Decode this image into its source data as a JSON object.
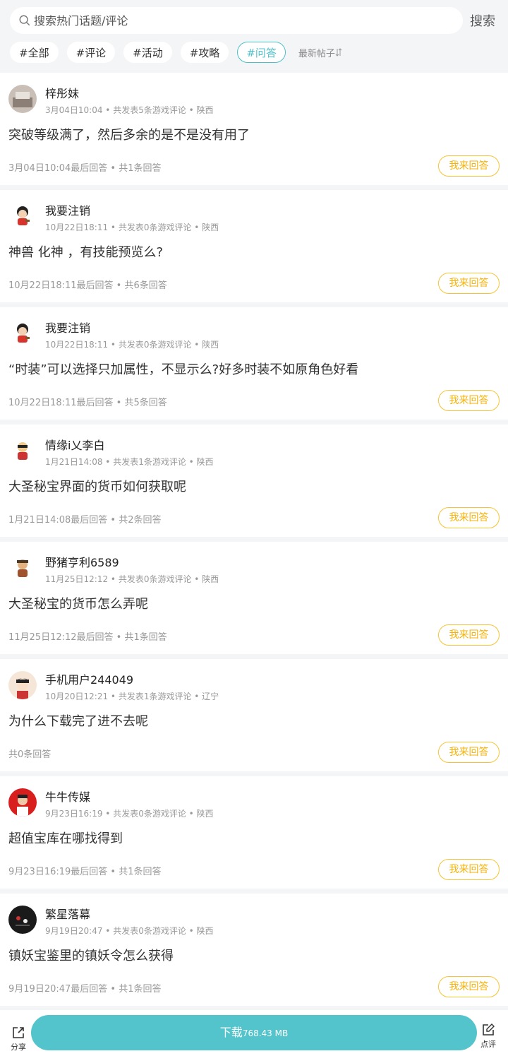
{
  "search": {
    "placeholder": "搜索热门话题/评论",
    "button_label": "搜索"
  },
  "tags": [
    {
      "label": "#全部"
    },
    {
      "label": "#评论"
    },
    {
      "label": "#活动"
    },
    {
      "label": "#攻略"
    },
    {
      "label": "#问答",
      "active": true
    }
  ],
  "sort_label": "最新帖子",
  "answer_label": "我来回答",
  "posts": [
    {
      "user": "梓彤妹",
      "meta": "3月04日10:04 • 共发表5条游戏评论 • 陕西",
      "title": "突破等级满了，然后多余的是不是没有用了",
      "footer": "3月04日10:04最后回答 • 共1条回答",
      "avatar_icon": "photo-avatar"
    },
    {
      "user": "我要注销",
      "meta": "10月22日18:11 • 共发表0条游戏评论 • 陕西",
      "title": "神兽 化神 ，有技能预览么?",
      "footer": "10月22日18:11最后回答 • 共6条回答",
      "avatar_icon": "cartoon-avatar"
    },
    {
      "user": "我要注销",
      "meta": "10月22日18:11 • 共发表0条游戏评论 • 陕西",
      "title": "“时装”可以选择只加属性，不显示么?好多时装不如原角色好看",
      "footer": "10月22日18:11最后回答 • 共5条回答",
      "avatar_icon": "cartoon-avatar"
    },
    {
      "user": "情缘i乂李白",
      "meta": "1月21日14:08 • 共发表1条游戏评论 • 陕西",
      "title": "大圣秘宝界面的货币如何获取呢",
      "footer": "1月21日14:08最后回答 • 共2条回答",
      "avatar_icon": "cartoon-avatar"
    },
    {
      "user": "野猪亨利6589",
      "meta": "11月25日12:12 • 共发表0条游戏评论 • 陕西",
      "title": "大圣秘宝的货币怎么弄呢",
      "footer": "11月25日12:12最后回答 • 共1条回答",
      "avatar_icon": "cartoon-avatar"
    },
    {
      "user": "手机用户244049",
      "meta": "10月20日12:21 • 共发表1条游戏评论 • 辽宁",
      "title": "为什么下载完了进不去呢",
      "footer": "共0条回答",
      "avatar_icon": "default-user-avatar"
    },
    {
      "user": "牛牛传媒",
      "meta": "9月23日16:19 • 共发表0条游戏评论 • 陕西",
      "title": "超值宝库在哪找得到",
      "footer": "9月23日16:19最后回答 • 共1条回答",
      "avatar_icon": "photo-avatar"
    },
    {
      "user": "繁星落幕",
      "meta": "9月19日20:47 • 共发表0条游戏评论 • 陕西",
      "title": "镇妖宝鉴里的镇妖令怎么获得",
      "footer": "9月19日20:47最后回答 • 共1条回答",
      "avatar_icon": "photo-avatar"
    }
  ],
  "bottom": {
    "share_label": "分享",
    "download_label": "下载",
    "download_size": "768.43 MB",
    "review_label": "点评"
  }
}
